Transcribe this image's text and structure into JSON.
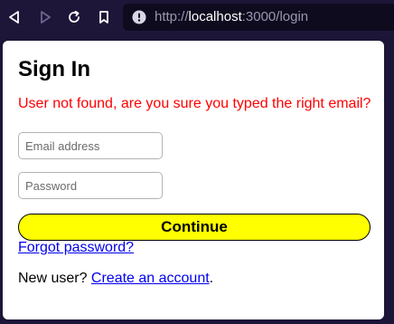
{
  "browser": {
    "url_host": "localhost",
    "url_port_path": ":3000/login",
    "url_scheme": "http://",
    "icons": {
      "back": "back-arrow-icon",
      "forward": "forward-arrow-icon",
      "reload": "reload-icon",
      "bookmark": "bookmark-icon",
      "info": "site-info-icon"
    }
  },
  "page": {
    "title": "Sign In",
    "error_message": "User not found, are you sure you typed the right email?",
    "email_placeholder": "Email address",
    "email_value": "",
    "password_placeholder": "Password",
    "password_value": "",
    "continue_label": "Continue",
    "forgot_link": "Forgot password?",
    "new_user_text": "New user? ",
    "create_account_link": "Create an account",
    "trailing_period": "."
  },
  "colors": {
    "error": "#ff0000",
    "button_bg": "#ffff00",
    "link": "#0000ee",
    "toolbar_bg": "#1e1638"
  }
}
